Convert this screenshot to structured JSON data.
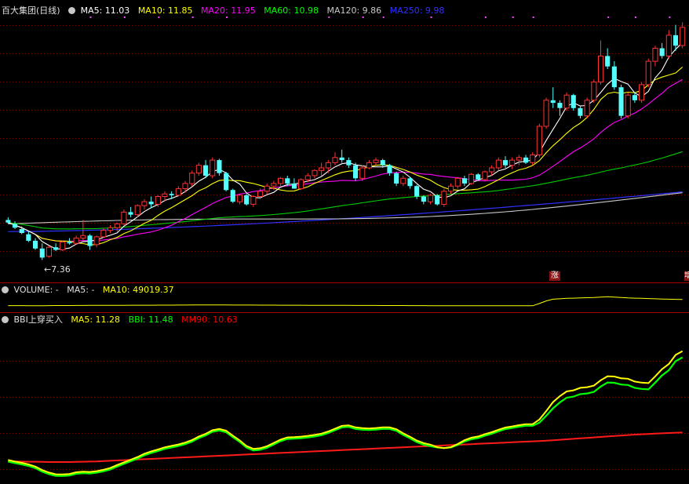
{
  "chart_data": [
    {
      "type": "candlestick",
      "title": "百大集团(日线)",
      "low_label": "7.36",
      "ylim": [
        6.8,
        16.6
      ],
      "legend": [
        {
          "label": "MA5: 11.03",
          "color": "#ffffff"
        },
        {
          "label": "MA10: 11.85",
          "color": "#ffff00"
        },
        {
          "label": "MA20: 11.95",
          "color": "#ff00ff"
        },
        {
          "label": "MA60: 10.98",
          "color": "#00ff00"
        },
        {
          "label": "MA120: 9.86",
          "color": "#c8c8c8"
        },
        {
          "label": "MA250: 9.98",
          "color": "#3030ff"
        }
      ],
      "x_count": 100,
      "ohlc": [
        [
          8.9,
          9.0,
          8.75,
          8.8
        ],
        [
          8.75,
          8.85,
          8.55,
          8.6
        ],
        [
          8.55,
          8.65,
          8.35,
          8.4
        ],
        [
          8.35,
          8.45,
          8.05,
          8.1
        ],
        [
          8.1,
          8.2,
          7.75,
          7.8
        ],
        [
          7.8,
          8.0,
          7.36,
          7.45
        ],
        [
          7.5,
          7.9,
          7.45,
          7.85
        ],
        [
          7.85,
          8.0,
          7.7,
          7.75
        ],
        [
          7.75,
          8.1,
          7.7,
          8.05
        ],
        [
          8.05,
          8.2,
          7.95,
          8.0
        ],
        [
          8.0,
          8.3,
          7.95,
          8.2
        ],
        [
          8.2,
          8.9,
          8.1,
          8.3
        ],
        [
          8.3,
          8.35,
          7.75,
          7.9
        ],
        [
          7.95,
          8.3,
          7.85,
          8.25
        ],
        [
          8.25,
          8.6,
          8.2,
          8.5
        ],
        [
          8.5,
          8.7,
          8.4,
          8.6
        ],
        [
          8.6,
          8.8,
          8.45,
          8.75
        ],
        [
          8.75,
          9.3,
          8.7,
          9.2
        ],
        [
          9.2,
          9.4,
          9.0,
          9.1
        ],
        [
          9.1,
          9.5,
          9.0,
          9.45
        ],
        [
          9.45,
          9.7,
          9.3,
          9.6
        ],
        [
          9.6,
          9.8,
          9.35,
          9.5
        ],
        [
          9.5,
          9.85,
          9.4,
          9.8
        ],
        [
          9.8,
          10.0,
          9.6,
          9.9
        ],
        [
          9.9,
          10.0,
          9.7,
          9.85
        ],
        [
          9.85,
          10.2,
          9.8,
          10.1
        ],
        [
          10.1,
          10.4,
          9.95,
          10.3
        ],
        [
          10.3,
          10.8,
          10.2,
          10.7
        ],
        [
          10.7,
          11.1,
          10.6,
          11.0
        ],
        [
          11.0,
          11.2,
          10.5,
          10.6
        ],
        [
          10.6,
          11.3,
          10.5,
          11.2
        ],
        [
          11.2,
          11.25,
          10.6,
          10.7
        ],
        [
          10.7,
          10.75,
          10.0,
          10.05
        ],
        [
          10.05,
          10.1,
          9.55,
          9.6
        ],
        [
          9.6,
          9.9,
          9.5,
          9.85
        ],
        [
          9.85,
          9.9,
          9.45,
          9.5
        ],
        [
          9.5,
          9.85,
          9.4,
          9.8
        ],
        [
          9.8,
          10.1,
          9.7,
          10.0
        ],
        [
          10.0,
          10.3,
          9.9,
          10.2
        ],
        [
          10.2,
          10.4,
          10.05,
          10.3
        ],
        [
          10.3,
          10.55,
          10.2,
          10.5
        ],
        [
          10.5,
          10.6,
          10.2,
          10.3
        ],
        [
          10.3,
          10.5,
          10.1,
          10.1
        ],
        [
          10.1,
          10.5,
          10.05,
          10.45
        ],
        [
          10.45,
          10.7,
          10.35,
          10.6
        ],
        [
          10.6,
          10.85,
          10.5,
          10.8
        ],
        [
          10.8,
          11.1,
          10.6,
          10.9
        ],
        [
          10.9,
          11.2,
          10.7,
          11.1
        ],
        [
          11.1,
          11.5,
          11.0,
          11.3
        ],
        [
          11.3,
          11.6,
          11.1,
          11.2
        ],
        [
          11.2,
          11.3,
          10.9,
          11.0
        ],
        [
          11.0,
          11.1,
          10.4,
          10.5
        ],
        [
          10.5,
          11.0,
          10.4,
          10.9
        ],
        [
          10.9,
          11.2,
          10.85,
          11.1
        ],
        [
          11.1,
          11.3,
          11.0,
          11.2
        ],
        [
          11.2,
          11.25,
          10.9,
          11.0
        ],
        [
          11.0,
          11.05,
          10.6,
          10.7
        ],
        [
          10.7,
          10.75,
          10.2,
          10.3
        ],
        [
          10.3,
          10.6,
          10.2,
          10.5
        ],
        [
          10.5,
          10.55,
          10.1,
          10.2
        ],
        [
          10.2,
          10.25,
          9.7,
          9.8
        ],
        [
          9.8,
          9.85,
          9.5,
          9.6
        ],
        [
          9.6,
          9.9,
          9.5,
          9.85
        ],
        [
          9.85,
          9.9,
          9.45,
          9.5
        ],
        [
          9.5,
          10.1,
          9.4,
          10.0
        ],
        [
          10.0,
          10.3,
          9.9,
          10.2
        ],
        [
          10.2,
          10.55,
          10.1,
          10.5
        ],
        [
          10.5,
          10.6,
          10.2,
          10.3
        ],
        [
          10.3,
          10.7,
          10.25,
          10.65
        ],
        [
          10.65,
          10.7,
          10.4,
          10.45
        ],
        [
          10.45,
          10.8,
          10.4,
          10.75
        ],
        [
          10.75,
          11.0,
          10.6,
          10.9
        ],
        [
          10.9,
          11.3,
          10.8,
          11.2
        ],
        [
          11.2,
          11.35,
          10.9,
          11.0
        ],
        [
          11.0,
          11.3,
          10.85,
          11.2
        ],
        [
          11.2,
          11.4,
          11.0,
          11.3
        ],
        [
          11.3,
          11.4,
          11.05,
          11.1
        ],
        [
          11.1,
          11.5,
          11.0,
          11.4
        ],
        [
          11.4,
          12.6,
          11.3,
          12.5
        ],
        [
          12.5,
          13.6,
          12.4,
          13.5
        ],
        [
          13.5,
          14.0,
          13.2,
          13.4
        ],
        [
          13.4,
          13.5,
          12.9,
          13.2
        ],
        [
          13.2,
          13.8,
          13.1,
          13.7
        ],
        [
          13.7,
          13.75,
          13.1,
          13.2
        ],
        [
          13.2,
          13.3,
          12.8,
          12.9
        ],
        [
          12.9,
          13.6,
          12.8,
          13.5
        ],
        [
          13.5,
          14.3,
          13.4,
          14.2
        ],
        [
          14.2,
          15.8,
          14.1,
          15.2
        ],
        [
          15.2,
          15.5,
          14.7,
          14.8
        ],
        [
          14.8,
          15.0,
          13.9,
          14.0
        ],
        [
          14.0,
          14.1,
          12.8,
          12.9
        ],
        [
          12.9,
          13.8,
          12.8,
          13.7
        ],
        [
          13.7,
          13.8,
          13.4,
          13.5
        ],
        [
          13.5,
          14.2,
          13.4,
          14.1
        ],
        [
          14.1,
          15.1,
          14.0,
          15.0
        ],
        [
          15.0,
          15.6,
          14.8,
          15.5
        ],
        [
          15.5,
          15.7,
          15.1,
          15.2
        ],
        [
          15.2,
          16.2,
          15.1,
          16.0
        ],
        [
          16.0,
          16.4,
          15.4,
          15.6
        ],
        [
          15.6,
          16.5,
          15.5,
          16.3
        ]
      ]
    },
    {
      "type": "line",
      "title": "VOLUME",
      "legend": [
        {
          "label": "VOLUME: -",
          "color": "#e0e0e0"
        },
        {
          "label": "MA5: -",
          "color": "#e0e0e0"
        },
        {
          "label": "MA10: 49019.37",
          "color": "#ffff00"
        }
      ],
      "series": [
        {
          "name": "MA10",
          "color": "#ffff00",
          "values": [
            20000,
            20000,
            19800,
            19600,
            19500,
            19700,
            19900,
            20100,
            20300,
            20400,
            20500,
            20800,
            20900,
            21000,
            21100,
            21200,
            21300,
            21500,
            21600,
            21700,
            21800,
            21900,
            22000,
            22100,
            22200,
            22300,
            22500,
            22700,
            22900,
            23000,
            22900,
            22800,
            22700,
            22600,
            22500,
            22400,
            22300,
            22200,
            22100,
            22000,
            21900,
            21800,
            21700,
            21600,
            21500,
            21400,
            21300,
            21200,
            21100,
            21000,
            20900,
            20800,
            20700,
            20600,
            20500,
            20400,
            20300,
            20200,
            20100,
            20000,
            19900,
            19800,
            19700,
            19700,
            19600,
            19600,
            19500,
            19500,
            19400,
            19400,
            19300,
            19300,
            19200,
            19200,
            19100,
            19100,
            19000,
            19000,
            30000,
            42000,
            50000,
            52000,
            54000,
            55000,
            56000,
            57000,
            58000,
            60000,
            62000,
            60000,
            58000,
            56000,
            55000,
            54000,
            53000,
            52000,
            51000,
            50000,
            49500,
            49019
          ]
        }
      ]
    },
    {
      "type": "line",
      "title": "BBI上穿买入",
      "legend": [
        {
          "label": "BBI上穿买入",
          "color": "#e0e0e0"
        },
        {
          "label": "MA5: 11.28",
          "color": "#ffff00"
        },
        {
          "label": "BBI: 11.48",
          "color": "#00ff00"
        },
        {
          "label": "MM90: 10.63",
          "color": "#ff0000"
        }
      ],
      "series": [
        {
          "name": "MA5",
          "color": "#ffff00",
          "values": [
            8.88,
            8.78,
            8.7,
            8.6,
            8.46,
            8.24,
            8.08,
            7.97,
            7.96,
            7.99,
            8.1,
            8.14,
            8.12,
            8.17,
            8.26,
            8.37,
            8.56,
            8.73,
            8.9,
            9.07,
            9.28,
            9.43,
            9.55,
            9.69,
            9.78,
            9.87,
            9.99,
            10.15,
            10.38,
            10.55,
            10.78,
            10.86,
            10.75,
            10.43,
            10.13,
            9.77,
            9.59,
            9.63,
            9.76,
            9.97,
            10.18,
            10.32,
            10.34,
            10.37,
            10.42,
            10.48,
            10.56,
            10.7,
            10.88,
            11.06,
            11.09,
            10.96,
            10.91,
            10.89,
            10.92,
            10.96,
            10.96,
            10.84,
            10.58,
            10.36,
            10.12,
            9.96,
            9.86,
            9.7,
            9.64,
            9.7,
            9.9,
            10.14,
            10.3,
            10.38,
            10.53,
            10.65,
            10.81,
            10.95,
            11.02,
            11.1,
            11.16,
            11.16,
            11.46,
            12.0,
            12.57,
            12.95,
            13.25,
            13.32,
            13.48,
            13.52,
            13.62,
            13.96,
            14.22,
            14.2,
            14.09,
            14.06,
            13.88,
            13.81,
            13.78,
            14.21,
            14.67,
            15.0,
            15.58,
            15.82
          ]
        },
        {
          "name": "BBI",
          "color": "#00ff00",
          "values": [
            8.78,
            8.68,
            8.6,
            8.5,
            8.36,
            8.14,
            7.98,
            7.87,
            7.86,
            7.89,
            8.0,
            8.04,
            8.02,
            8.07,
            8.16,
            8.27,
            8.46,
            8.63,
            8.8,
            8.97,
            9.18,
            9.33,
            9.45,
            9.59,
            9.68,
            9.77,
            9.89,
            10.05,
            10.28,
            10.45,
            10.68,
            10.76,
            10.65,
            10.33,
            10.03,
            9.67,
            9.49,
            9.53,
            9.66,
            9.87,
            10.08,
            10.22,
            10.24,
            10.27,
            10.32,
            10.38,
            10.46,
            10.6,
            10.78,
            10.96,
            10.99,
            10.86,
            10.81,
            10.79,
            10.82,
            10.86,
            10.86,
            10.74,
            10.48,
            10.26,
            10.02,
            9.86,
            9.76,
            9.68,
            9.64,
            9.68,
            9.84,
            10.06,
            10.2,
            10.28,
            10.43,
            10.55,
            10.71,
            10.85,
            10.92,
            11.0,
            11.06,
            11.06,
            11.26,
            11.7,
            12.17,
            12.55,
            12.85,
            12.92,
            13.08,
            13.12,
            13.22,
            13.56,
            13.82,
            13.8,
            13.69,
            13.66,
            13.48,
            13.41,
            13.38,
            13.81,
            14.27,
            14.6,
            15.18,
            15.42
          ]
        },
        {
          "name": "MM90",
          "color": "#ff0000",
          "values": [
            8.8,
            8.79,
            8.78,
            8.77,
            8.77,
            8.76,
            8.75,
            8.75,
            8.75,
            8.75,
            8.76,
            8.77,
            8.78,
            8.79,
            8.81,
            8.83,
            8.85,
            8.87,
            8.89,
            8.91,
            8.93,
            8.95,
            8.97,
            8.99,
            9.01,
            9.03,
            9.05,
            9.07,
            9.09,
            9.11,
            9.13,
            9.15,
            9.17,
            9.19,
            9.21,
            9.23,
            9.25,
            9.27,
            9.29,
            9.31,
            9.33,
            9.35,
            9.37,
            9.39,
            9.41,
            9.43,
            9.45,
            9.47,
            9.49,
            9.51,
            9.53,
            9.55,
            9.57,
            9.59,
            9.61,
            9.63,
            9.65,
            9.67,
            9.69,
            9.71,
            9.73,
            9.75,
            9.77,
            9.79,
            9.81,
            9.83,
            9.85,
            9.87,
            9.89,
            9.91,
            9.93,
            9.95,
            9.97,
            9.99,
            10.01,
            10.03,
            10.05,
            10.07,
            10.09,
            10.11,
            10.14,
            10.17,
            10.2,
            10.23,
            10.26,
            10.29,
            10.32,
            10.35,
            10.38,
            10.41,
            10.44,
            10.47,
            10.5,
            10.52,
            10.54,
            10.56,
            10.58,
            10.6,
            10.62,
            10.63
          ]
        }
      ]
    }
  ],
  "tags": [
    "涨",
    "增"
  ]
}
